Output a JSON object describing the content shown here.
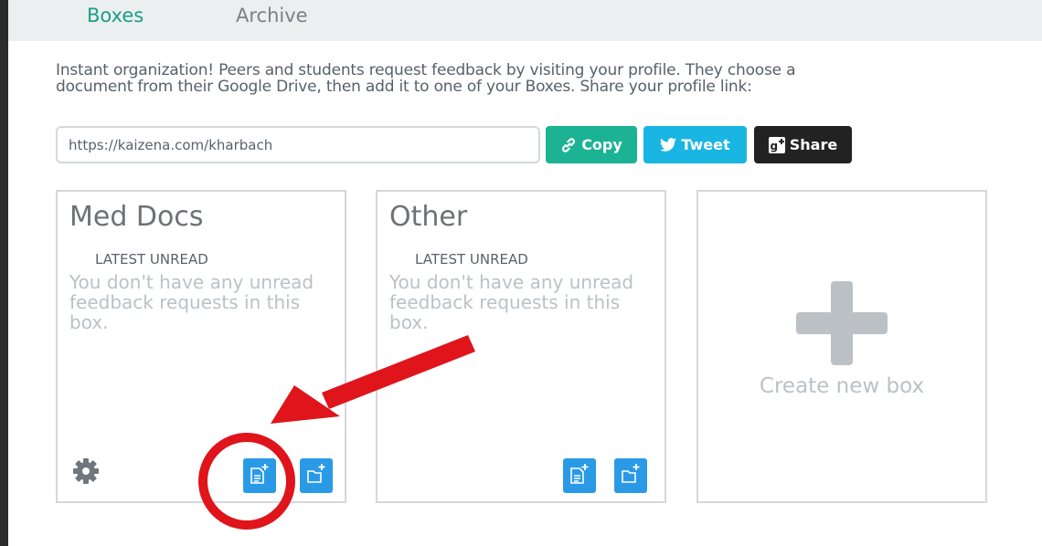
{
  "tabs": {
    "boxes": "Boxes",
    "archive": "Archive"
  },
  "intro": {
    "text": "Instant organization! Peers and students request feedback by visiting your profile. They choose a document from their Google Drive, then add it to one of your Boxes. Share your profile link:"
  },
  "profile_link": {
    "value": "https://kaizena.com/kharbach"
  },
  "share_buttons": {
    "copy": "Copy",
    "tweet": "Tweet",
    "share": "Share"
  },
  "boxes": [
    {
      "title": "Med Docs",
      "latest_label": "LATEST UNREAD",
      "empty_message": "You don't have any unread feedback requests in this box."
    },
    {
      "title": "Other",
      "latest_label": "LATEST UNREAD",
      "empty_message": "You don't have any unread feedback requests in this box."
    }
  ],
  "create_box": {
    "label": "Create new box"
  },
  "icons": {
    "copy": "link-icon",
    "tweet": "twitter-icon",
    "share": "google-plus-icon",
    "settings": "gear-icon",
    "add_document": "add-document-icon",
    "add_folder": "add-folder-icon",
    "create": "plus-icon"
  },
  "colors": {
    "accent": "#1a9e8a",
    "copy_button": "#1bb394",
    "tweet_button": "#19b6e3",
    "share_button": "#222222",
    "box_action": "#2a9ae6",
    "annotation": "#e0141b"
  }
}
